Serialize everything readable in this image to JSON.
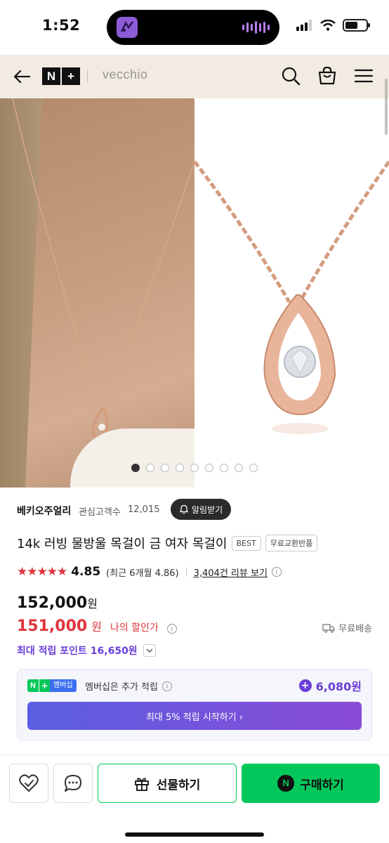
{
  "status_bar": {
    "time": "1:52"
  },
  "nav": {
    "brand": "vecchio",
    "logo_letters": [
      "N",
      "+"
    ]
  },
  "gallery": {
    "total_images": 9,
    "active_index": 0
  },
  "store": {
    "name": "베키오주얼리",
    "fans_label": "관심고객수",
    "fans_count": "12,015",
    "alert_label": "알림받기"
  },
  "product": {
    "title": "14k 러빙 물방울 목걸이 금 여자 목걸이",
    "tags": [
      "BEST",
      "무료교환반품"
    ]
  },
  "rating": {
    "stars": "★★★★★",
    "score": "4.85",
    "recent": "(최근 6개월 4.86)",
    "review_link": "3,404건 리뷰 보기"
  },
  "price": {
    "original": "152,000",
    "original_unit": "원",
    "sale": "151,000",
    "sale_unit": "원",
    "my_discount_label": "나의 할인가",
    "delivery": "무료배송"
  },
  "points": {
    "max_points_text": "최대 적립 포인트 16,650원"
  },
  "membership": {
    "badge_n": "N",
    "badge_plus": "+",
    "badge_label": "멤버십",
    "text": "멤버십은 추가 적립",
    "extra_points": "6,080원",
    "cta": "최대 5% 적립 시작하기 ›"
  },
  "bottom_bar": {
    "gift_label": "선물하기",
    "buy_label": "구매하기",
    "buy_badge": "N"
  }
}
